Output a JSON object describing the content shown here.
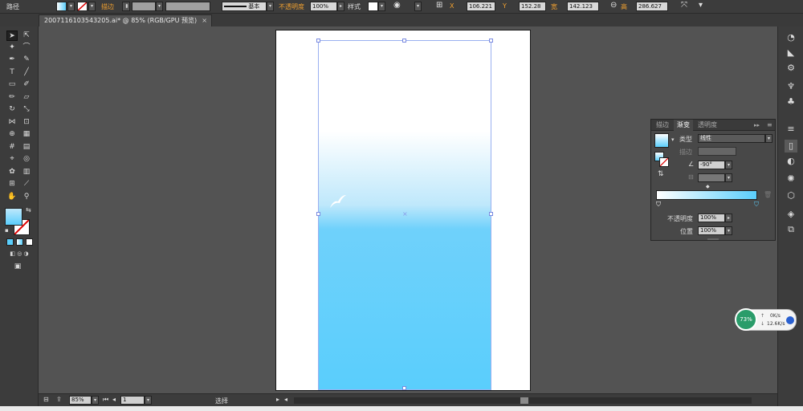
{
  "control_bar": {
    "path_label": "路径",
    "stroke_label": "描边",
    "stroke_profile": "基本",
    "opacity_label": "不透明度",
    "opacity_value": "100%",
    "style_label": "样式",
    "x_label": "X",
    "x_value": "106.221",
    "y_label": "Y",
    "y_value": "152.28",
    "w_label": "宽",
    "w_value": "142.123",
    "h_label": "高",
    "h_value": "286.627",
    "fill_color": "#8fd8f8",
    "stroke_color": "#ffffff"
  },
  "document": {
    "tab_title": "20071161035432​05.ai* @ 85% (RGB/GPU 预览)",
    "close_glyph": "×"
  },
  "gradient_panel": {
    "tabs": [
      "描边",
      "渐变",
      "透明度"
    ],
    "active_tab": 1,
    "menu_glyph": "≡",
    "collapse_glyph": "▸▸",
    "type_label": "类型",
    "type_value": "线性",
    "stroke_label": "描边",
    "angle_value": "-90°",
    "opacity_label": "不透明度",
    "opacity_value": "100%",
    "position_label": "位置",
    "position_value": "100%",
    "gradient_start": "#ffffff",
    "gradient_end": "#5acefc"
  },
  "status_bar": {
    "zoom": "85%",
    "artboard_number": "1",
    "tool_name": "选择"
  },
  "net_widget": {
    "percent": "73%",
    "upload": "0K/s",
    "download": "12.6K/s"
  },
  "colors": {
    "accent_blue": "#5acefc",
    "panel_bg": "#484848",
    "ui_dark": "#3c3c3c",
    "canvas_bg": "#535353"
  }
}
